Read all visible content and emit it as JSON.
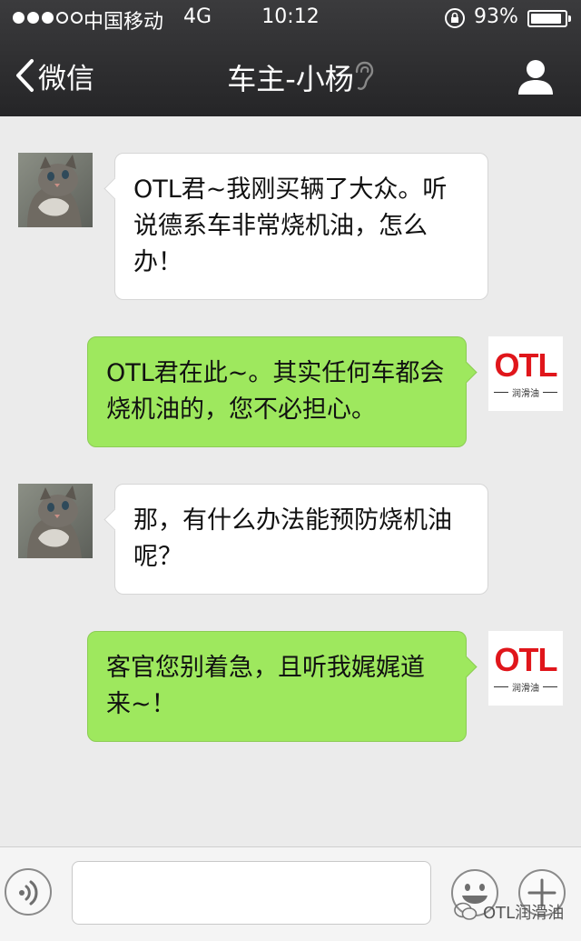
{
  "status_bar": {
    "signal_dots_filled": 3,
    "signal_dots_total": 5,
    "carrier": "中国移动",
    "network": "4G",
    "time": "10:12",
    "battery_percent": "93%",
    "battery_level": 0.93
  },
  "nav": {
    "back_label": "微信",
    "title": "车主-小杨",
    "icons": [
      "chevron-left-icon",
      "ear-icon",
      "profile-icon"
    ]
  },
  "messages": [
    {
      "from": "other",
      "text": "OTL君~我刚买辆了大众。听说德系车非常烧机油，怎么办！"
    },
    {
      "from": "me",
      "text": "OTL君在此~。其实任何车都会烧机油的，您不必担心。"
    },
    {
      "from": "other",
      "text": "那，有什么办法能预防烧机油呢？"
    },
    {
      "from": "me",
      "text": "客官您别着急，且听我娓娓道来~！"
    }
  ],
  "otl_logo": {
    "text": "OTL",
    "subtext": "润滑油"
  },
  "input_bar": {
    "value": "",
    "placeholder": "",
    "icons": [
      "voice-icon",
      "emoji-icon",
      "plus-icon"
    ]
  },
  "watermark": {
    "text": "OTL润滑油"
  },
  "colors": {
    "header": "#2d2d2f",
    "chat_background": "#ebebeb",
    "outgoing_bubble": "#9ee85e",
    "incoming_bubble": "#ffffff",
    "logo_red": "#e0161b"
  }
}
